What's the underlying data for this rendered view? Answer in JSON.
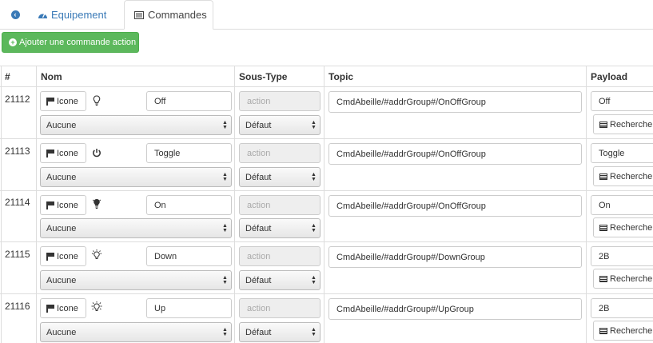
{
  "tabs": {
    "back_icon": "arrow-circle-left-icon",
    "equipement": "Equipement",
    "commandes": "Commandes"
  },
  "add_button": "Ajouter une commande action",
  "table": {
    "headers": {
      "id": "#",
      "nom": "Nom",
      "sous_type": "Sous-Type",
      "topic": "Topic",
      "payload": "Payload"
    },
    "icone_label": "Icone",
    "rechercher_label": "Rechercher",
    "rows": [
      {
        "id": "21112",
        "icon": "lightbulb-outline-icon",
        "name": "Off",
        "dropdown": "Aucune",
        "subtype_value": "action",
        "subtype_select": "Défaut",
        "topic": "CmdAbeille/#addrGroup#/OnOffGroup",
        "payload": "Off"
      },
      {
        "id": "21113",
        "icon": "power-icon",
        "name": "Toggle",
        "dropdown": "Aucune",
        "subtype_value": "action",
        "subtype_select": "Défaut",
        "topic": "CmdAbeille/#addrGroup#/OnOffGroup",
        "payload": "Toggle"
      },
      {
        "id": "21114",
        "icon": "lightbulb-filled-icon",
        "name": "On",
        "dropdown": "Aucune",
        "subtype_value": "action",
        "subtype_select": "Défaut",
        "topic": "CmdAbeille/#addrGroup#/OnOffGroup",
        "payload": "On"
      },
      {
        "id": "21115",
        "icon": "lightbulb-dim-icon",
        "name": "Down",
        "dropdown": "Aucune",
        "subtype_value": "action",
        "subtype_select": "Défaut",
        "topic": "CmdAbeille/#addrGroup#/DownGroup",
        "payload": "2B"
      },
      {
        "id": "21116",
        "icon": "lightbulb-bright-icon",
        "name": "Up",
        "dropdown": "Aucune",
        "subtype_value": "action",
        "subtype_select": "Défaut",
        "topic": "CmdAbeille/#addrGroup#/UpGroup",
        "payload": "2B"
      }
    ]
  },
  "colors": {
    "accent": "#3a7ab7",
    "success": "#5cb85c",
    "border": "#dddddd"
  }
}
